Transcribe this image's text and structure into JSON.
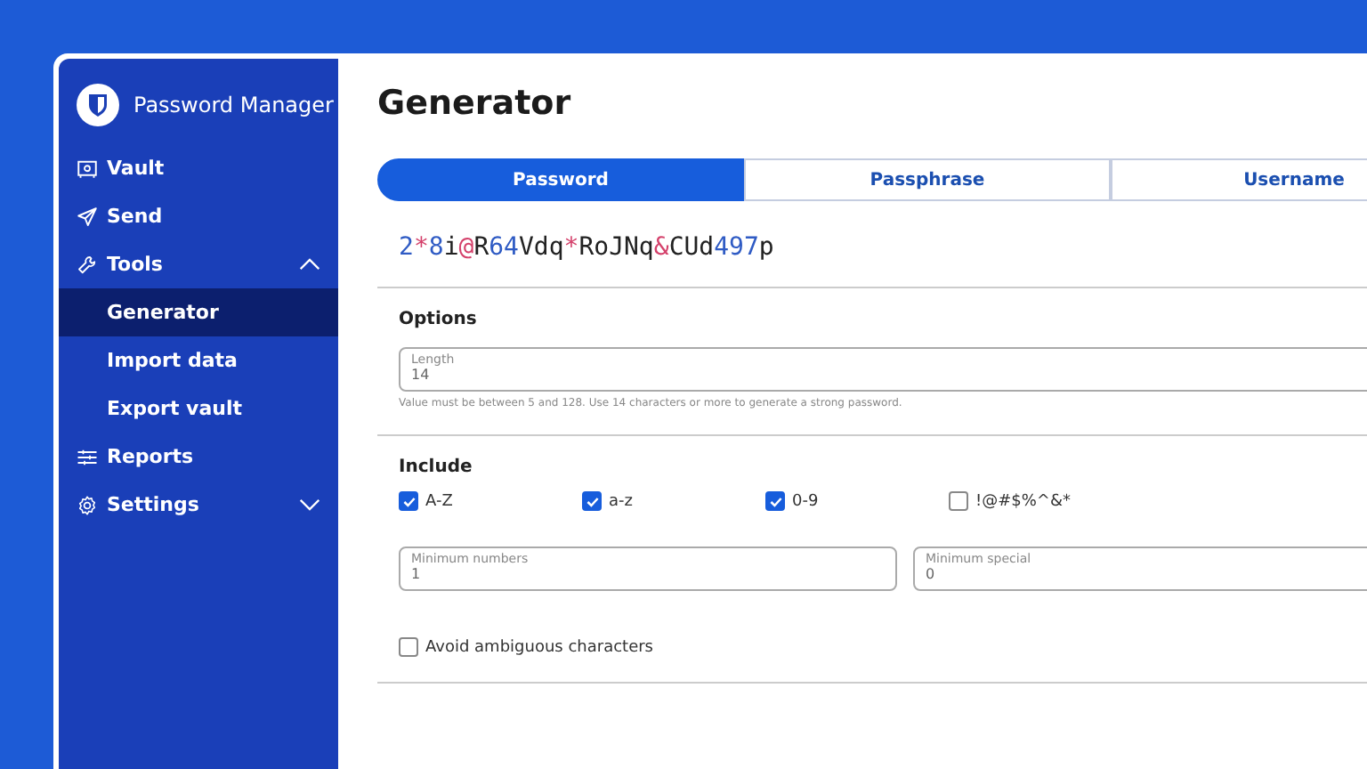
{
  "sidebar": {
    "app_name": "Password Manager",
    "items": [
      {
        "label": "Vault",
        "kind": "vault",
        "selected": false
      },
      {
        "label": "Send",
        "kind": "send",
        "selected": false
      },
      {
        "label": "Tools",
        "kind": "tools",
        "selected": false,
        "expanded": true,
        "children": [
          {
            "label": "Generator",
            "selected": true
          },
          {
            "label": "Import data",
            "selected": false
          },
          {
            "label": "Export vault",
            "selected": false
          }
        ]
      },
      {
        "label": "Reports",
        "kind": "reports",
        "selected": false
      },
      {
        "label": "Settings",
        "kind": "settings",
        "selected": false,
        "expanded": false
      }
    ]
  },
  "page_title": "Generator",
  "tabs": [
    {
      "label": "Password",
      "selected": true
    },
    {
      "label": "Passphrase",
      "selected": false
    },
    {
      "label": "Username",
      "selected": false
    }
  ],
  "generated_password": [
    {
      "text": "2",
      "kind": "number"
    },
    {
      "text": "*",
      "kind": "special"
    },
    {
      "text": "8",
      "kind": "number"
    },
    {
      "text": "i",
      "kind": "letter"
    },
    {
      "text": "@",
      "kind": "special"
    },
    {
      "text": "R",
      "kind": "letter"
    },
    {
      "text": "64",
      "kind": "number"
    },
    {
      "text": "Vdq",
      "kind": "letter"
    },
    {
      "text": "*",
      "kind": "special"
    },
    {
      "text": "RoJNq",
      "kind": "letter"
    },
    {
      "text": "&",
      "kind": "special"
    },
    {
      "text": "CUd",
      "kind": "letter"
    },
    {
      "text": "497",
      "kind": "number"
    },
    {
      "text": "p",
      "kind": "letter"
    }
  ],
  "options": {
    "heading": "Options",
    "length": {
      "label": "Length",
      "value": "14",
      "hint": "Value must be between 5 and 128. Use 14 characters or more to generate a strong password."
    }
  },
  "include": {
    "heading": "Include",
    "checkboxes": [
      {
        "label": "A-Z",
        "checked": true
      },
      {
        "label": "a-z",
        "checked": true
      },
      {
        "label": "0-9",
        "checked": true
      },
      {
        "label": "!@#$%^&*",
        "checked": false
      }
    ],
    "fields": [
      {
        "label": "Minimum numbers",
        "value": "1"
      },
      {
        "label": "Minimum special",
        "value": "0"
      }
    ],
    "avoid_ambiguous": {
      "label": "Avoid ambiguous characters",
      "checked": false
    }
  }
}
